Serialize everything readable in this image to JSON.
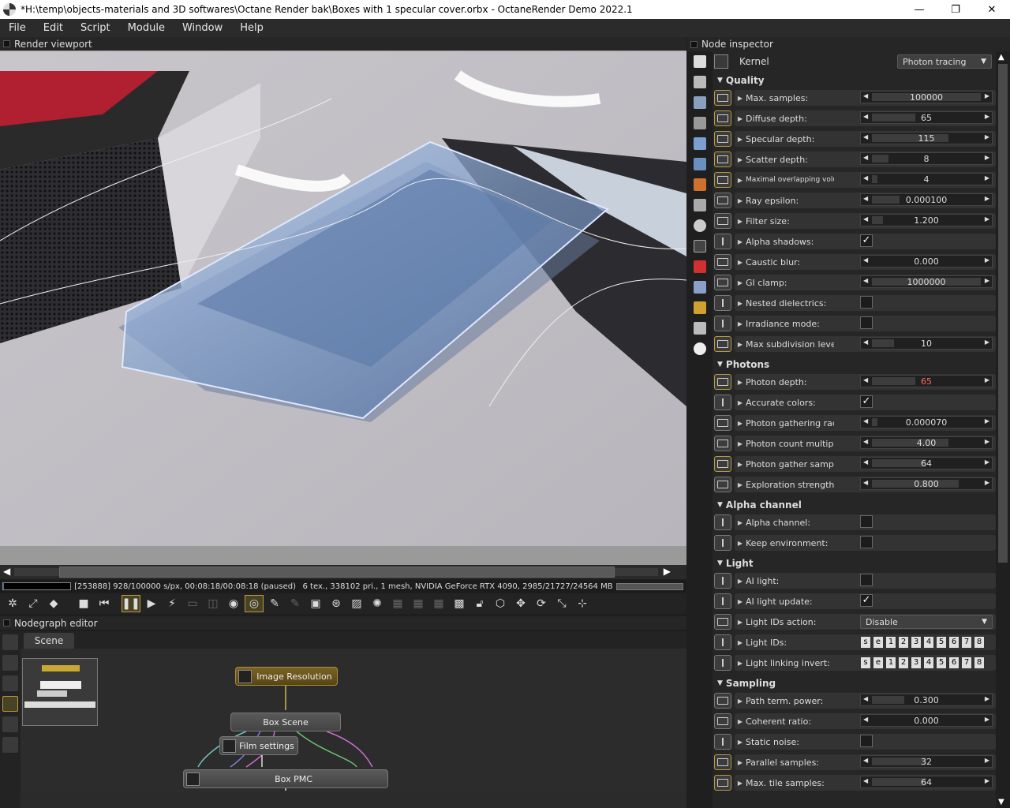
{
  "titlebar": {
    "title": "*H:\\temp\\objects-materials and 3D softwares\\Octane Render bak\\Boxes with 1 specular cover.orbx - OctaneRender Demo 2022.1",
    "minimize": "—",
    "maximize": "❐",
    "close": "✕"
  },
  "menu": [
    "File",
    "Edit",
    "Script",
    "Module",
    "Window",
    "Help"
  ],
  "viewport": {
    "header": "Render viewport",
    "status": "[253888] 928/100000 s/px, 00:08:18/00:08:18 (paused)",
    "stats": "6 tex., 338102 pri., 1 mesh, NVIDIA GeForce RTX 4090, 2985/21727/24564 MB",
    "progress": 0.009
  },
  "nodegraph": {
    "header": "Nodegraph editor",
    "tab": "Scene",
    "nodes": {
      "image_resolution": "Image Resolution",
      "box_scene": "Box Scene",
      "film_settings": "Film settings",
      "box_pmc": "Box PMC"
    }
  },
  "inspector": {
    "header": "Node inspector",
    "kernel_label": "Kernel",
    "kernel_value": "Photon tracing",
    "sections": {
      "quality": "Quality",
      "photons": "Photons",
      "alpha": "Alpha channel",
      "light": "Light",
      "sampling": "Sampling"
    },
    "params": [
      {
        "label": "Max. samples:",
        "value": "100000",
        "fill": 1.0
      },
      {
        "label": "Diffuse depth:",
        "value": "65",
        "fill": 0.4
      },
      {
        "label": "Specular depth:",
        "value": "115",
        "fill": 0.7
      },
      {
        "label": "Scatter depth:",
        "value": "8",
        "fill": 0.15
      },
      {
        "label": "Maximal overlapping volumes:",
        "value": "4",
        "fill": 0.05
      },
      {
        "label": "Ray epsilon:",
        "value": "0.000100",
        "fill": 0.25
      },
      {
        "label": "Filter size:",
        "value": "1.200",
        "fill": 0.1
      },
      {
        "label": "Alpha shadows:",
        "checked": true
      },
      {
        "label": "Caustic blur:",
        "value": "0.000",
        "fill": 0.0
      },
      {
        "label": "GI clamp:",
        "value": "1000000",
        "fill": 1.0
      },
      {
        "label": "Nested dielectrics:",
        "checked": false
      },
      {
        "label": "Irradiance mode:",
        "checked": false
      },
      {
        "label": "Max subdivision level:",
        "value": "10",
        "fill": 0.2
      },
      {
        "label": "Photon depth:",
        "value": "65",
        "fill": 0.4
      },
      {
        "label": "Accurate colors:",
        "checked": true
      },
      {
        "label": "Photon gathering radius:",
        "value": "0.000070",
        "fill": 0.05
      },
      {
        "label": "Photon count multiplier:",
        "value": "4.00",
        "fill": 0.7
      },
      {
        "label": "Photon gather samples:",
        "value": "64",
        "fill": 0.5
      },
      {
        "label": "Exploration strength:",
        "value": "0.800",
        "fill": 0.8
      },
      {
        "label": "Alpha channel:",
        "checked": false
      },
      {
        "label": "Keep environment:",
        "checked": false
      },
      {
        "label": "AI light:",
        "checked": false
      },
      {
        "label": "AI light update:",
        "checked": true
      },
      {
        "label": "Light IDs action:",
        "select": "Disable"
      },
      {
        "label": "Light IDs:",
        "ids": [
          "s",
          "e",
          "1",
          "2",
          "3",
          "4",
          "5",
          "6",
          "7",
          "8"
        ]
      },
      {
        "label": "Light linking invert:",
        "ids": [
          "s",
          "e",
          "1",
          "2",
          "3",
          "4",
          "5",
          "6",
          "7",
          "8"
        ]
      },
      {
        "label": "Path term. power:",
        "value": "0.300",
        "fill": 0.3
      },
      {
        "label": "Coherent ratio:",
        "value": "0.000",
        "fill": 0.0
      },
      {
        "label": "Static noise:",
        "checked": false
      },
      {
        "label": "Parallel samples:",
        "value": "32",
        "fill": 0.5
      },
      {
        "label": "Max. tile samples:",
        "value": "64",
        "fill": 0.5
      }
    ]
  },
  "colors": {
    "accent": "#b79a3b",
    "red_value": "#ff6a5a"
  }
}
